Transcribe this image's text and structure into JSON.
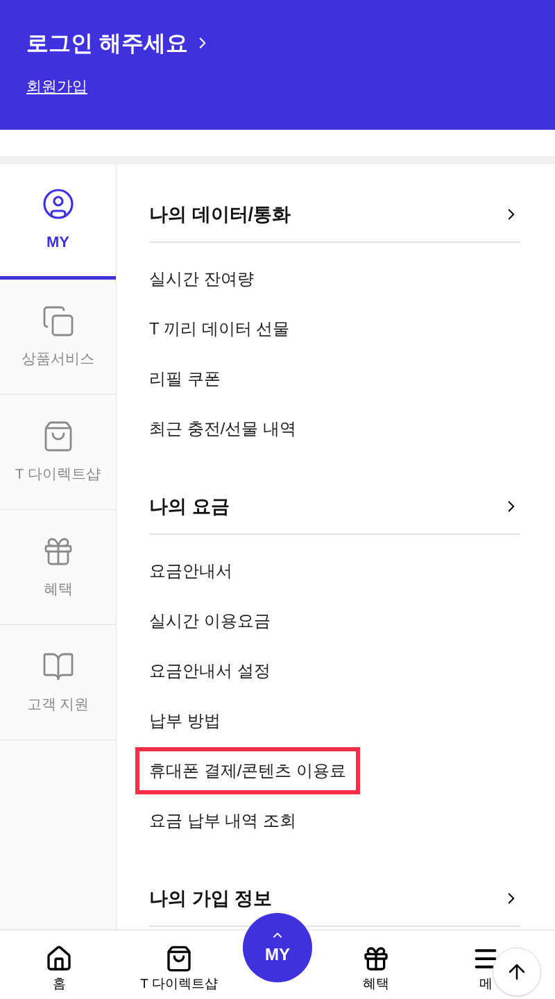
{
  "header": {
    "title": "로그인 해주세요",
    "signup_link": "회원가입"
  },
  "sidebar": {
    "items": [
      {
        "label": "MY",
        "kind": "user",
        "selected": true
      },
      {
        "label": "상품서비스",
        "kind": "cards",
        "selected": false
      },
      {
        "label": "T 다이렉트샵",
        "kind": "bag",
        "selected": false
      },
      {
        "label": "혜택",
        "kind": "gift",
        "selected": false
      },
      {
        "label": "고객 지원",
        "kind": "book",
        "selected": false
      }
    ]
  },
  "sections": [
    {
      "title": "나의 데이터/통화",
      "items": [
        {
          "label": "실시간 잔여량",
          "highlighted": false
        },
        {
          "label": "T 끼리 데이터 선물",
          "highlighted": false
        },
        {
          "label": "리필 쿠폰",
          "highlighted": false
        },
        {
          "label": "최근 충전/선물 내역",
          "highlighted": false
        }
      ]
    },
    {
      "title": "나의 요금",
      "items": [
        {
          "label": "요금안내서",
          "highlighted": false
        },
        {
          "label": "실시간 이용요금",
          "highlighted": false
        },
        {
          "label": "요금안내서 설정",
          "highlighted": false
        },
        {
          "label": "납부 방법",
          "highlighted": false
        },
        {
          "label": "휴대폰 결제/콘텐츠 이용료",
          "highlighted": true
        },
        {
          "label": "요금 납부 내역 조회",
          "highlighted": false
        }
      ]
    },
    {
      "title": "나의 가입 정보"
    }
  ],
  "bottom_nav": {
    "items": [
      {
        "label": "홈",
        "kind": "home"
      },
      {
        "label": "T 다이렉트샵",
        "kind": "bag"
      },
      {
        "label": "혜택",
        "kind": "gift"
      },
      {
        "label": "메",
        "kind": "menu"
      }
    ],
    "center_button": {
      "label": "MY"
    }
  }
}
